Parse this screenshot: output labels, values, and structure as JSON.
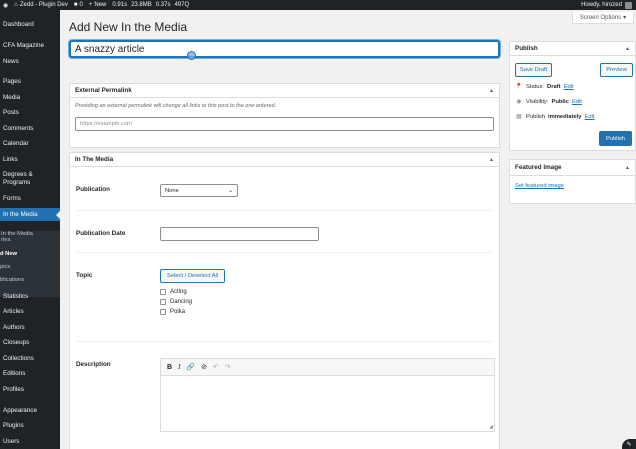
{
  "admin_bar": {
    "site_name": "Zedd - Plugin Dev",
    "comments_count": "0",
    "new_label": "New",
    "perf_time": "0.91s",
    "perf_mem": "23.8MB",
    "perf_q": "0.37s",
    "perf_queries": "497Q",
    "howdy": "Howdy, hirozed"
  },
  "sidebar": {
    "dashboard": "Dashboard",
    "cfa_magazine": "CFA Magazine",
    "news": "News",
    "pages": "Pages",
    "media": "Media",
    "posts": "Posts",
    "comments": "Comments",
    "calendar": "Calendar",
    "links": "Links",
    "degrees_line1": "Degrees &",
    "degrees_line2": "Programs",
    "forms": "Forms",
    "in_the_media": "In the Media",
    "sub_all_line1": "In the Media",
    "sub_all_line2": "ries",
    "sub_add_new": "d New",
    "sub_topics": "pics",
    "sub_publications": "blications",
    "statistics": "Statistics",
    "articles": "Articles",
    "authors": "Authors",
    "closeups": "Closeups",
    "collections": "Collections",
    "editions": "Editions",
    "profiles": "Profiles",
    "appearance": "Appearance",
    "plugins": "Plugins",
    "users": "Users"
  },
  "header": {
    "screen_options": "Screen Options",
    "page_title": "Add New In the Media",
    "title_value": "A snazzy article"
  },
  "external_permalink": {
    "heading": "External Permalink",
    "help": "Providing an external permalink will change all links to this post to the one entered.",
    "placeholder": "https://example.com"
  },
  "in_the_media": {
    "heading": "In The Media",
    "publication_label": "Publication",
    "publication_value": "None",
    "date_label": "Publication Date",
    "topic_label": "Topic",
    "select_all": "Select / Deselect All",
    "topics": [
      "Acting",
      "Dancing",
      "Polka"
    ],
    "description_label": "Description"
  },
  "publish": {
    "heading": "Publish",
    "save_draft": "Save Draft",
    "preview": "Preview",
    "status_label": "Status:",
    "status_value": "Draft",
    "visibility_label": "Visibility:",
    "visibility_value": "Public",
    "publish_label": "Publish",
    "publish_value": "immediately",
    "edit": "Edit",
    "publish_button": "Publish"
  },
  "featured_image": {
    "heading": "Featured Image",
    "link": "Set featured image"
  },
  "icons": {
    "wp_logo": "wordpress-icon",
    "comments": "comment-icon",
    "plus": "plus-icon",
    "status": "pin-icon",
    "visibility": "eye-icon",
    "calendar": "calendar-icon"
  }
}
